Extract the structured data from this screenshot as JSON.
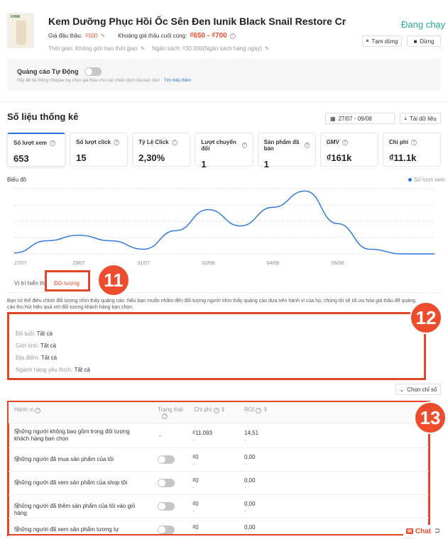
{
  "product": {
    "name": "Kem Dưỡng Phục Hồi Ốc Sên Đen Iunik Black Snail Restore Cream…",
    "status": "Đang chạy",
    "bid_label": "Giá đấu thầu:",
    "bid_value": "₫500",
    "final_bid_label": "Khoảng giá thầu cuối cùng:",
    "final_bid_value": "₫650 - ₫700",
    "time_text": "Thời gian: Không giới hạn thời gian",
    "budget_text": "Ngân sách: ₫30.000(Ngân sách hàng ngày)",
    "pause_label": "Tạm dừng",
    "stop_label": "Dừng",
    "thumb_text": "IUNIK"
  },
  "auto_ads": {
    "title": "Quảng cáo Tự Động",
    "desc": "Hãy để hệ thống Shopee tùy chọn giá thầu cho các chiến dịch của bạn nhé!",
    "learn_more": "Tìm hiểu thêm"
  },
  "stats": {
    "title": "Số liệu thống kê",
    "date_range": "27/07 - 09/08",
    "download_label": "Tải dữ liệu",
    "cards": [
      {
        "label": "Số lượt xem",
        "value": "653"
      },
      {
        "label": "Số lượt click",
        "value": "15"
      },
      {
        "label": "Tỷ Lệ Click",
        "value": "2,30%"
      },
      {
        "label": "Lượt chuyển đổi",
        "value": "1"
      },
      {
        "label": "Sản phẩm đã bán",
        "value": "1"
      },
      {
        "label": "GMV",
        "value": "₫161k"
      },
      {
        "label": "Chi phí",
        "value": "₫11.1k"
      }
    ]
  },
  "chart_data": {
    "type": "line",
    "title": "Biểu đồ",
    "legend": "Số lượt xem",
    "legend_position": "top-right",
    "x_ticks": [
      "27/07",
      "29/07",
      "31/07",
      "02/08",
      "04/08",
      "06/08"
    ],
    "series": [
      {
        "name": "Số lượt xem",
        "x": [
          "27/07",
          "28/07",
          "29/07",
          "30/07",
          "31/07",
          "01/08",
          "02/08",
          "03/08",
          "04/08",
          "05/08",
          "06/08",
          "07/08",
          "08/08",
          "09/08"
        ],
        "values": [
          2,
          28,
          40,
          28,
          10,
          50,
          95,
          60,
          100,
          135,
          65,
          10,
          0,
          0
        ]
      }
    ],
    "color": "#2673dd",
    "grid": true
  },
  "tabs": {
    "placement": "Vị trí hiển thị",
    "audience": "Đối tượng"
  },
  "badges": {
    "b11": "11",
    "b12": "12",
    "b13": "13"
  },
  "audience": {
    "desc": "Bạn có thể điều chỉnh đối tượng nhìn thấy quảng cáo. Nếu bạn muốn nhắm đến đối tượng người nhìn thấy quảng cáo dựa trên hành vi của họ, chúng tôi sẽ tối ưu hóa giá thầu để quảng cáo thu hút hiệu quả với đối tượng khách hàng bạn chọn.",
    "age_label": "Độ tuổi:",
    "age_value": "Tất cả",
    "gender_label": "Giới tính:",
    "gender_value": "Tất cả",
    "location_label": "Địa điểm:",
    "location_value": "Tất cả",
    "interest_label": "Ngành hàng yêu thích:",
    "interest_value": "Tất cả",
    "choose_metrics": "Chọn chỉ số"
  },
  "table": {
    "headers": {
      "behavior": "Hành vi",
      "status": "Trạng thái",
      "cost": "Chi phí",
      "roi": "ROI"
    },
    "rows": [
      {
        "behavior": "Những người không bao gồm trong đối tượng khách hàng bạn chọn",
        "status": "-",
        "cost": "₫11.093",
        "roi": "14,51",
        "toggle": false
      },
      {
        "behavior": "Những người đã mua sản phẩm của tôi",
        "status": "",
        "cost": "₫0",
        "roi": "0,00",
        "toggle": true
      },
      {
        "behavior": "Những người đã xem sản phẩm của shop tôi",
        "status": "",
        "cost": "₫0",
        "roi": "0,00",
        "toggle": true
      },
      {
        "behavior": "Những người đã thêm sản phẩm của tôi vào giỏ hàng",
        "status": "",
        "cost": "₫0",
        "roi": "0,00",
        "toggle": true
      },
      {
        "behavior": "Những người đã xem sản phẩm tương tự",
        "status": "",
        "cost": "₫0",
        "roi": "0,00",
        "toggle": true
      }
    ],
    "dash": "-"
  },
  "chat": {
    "label": "Chat"
  }
}
